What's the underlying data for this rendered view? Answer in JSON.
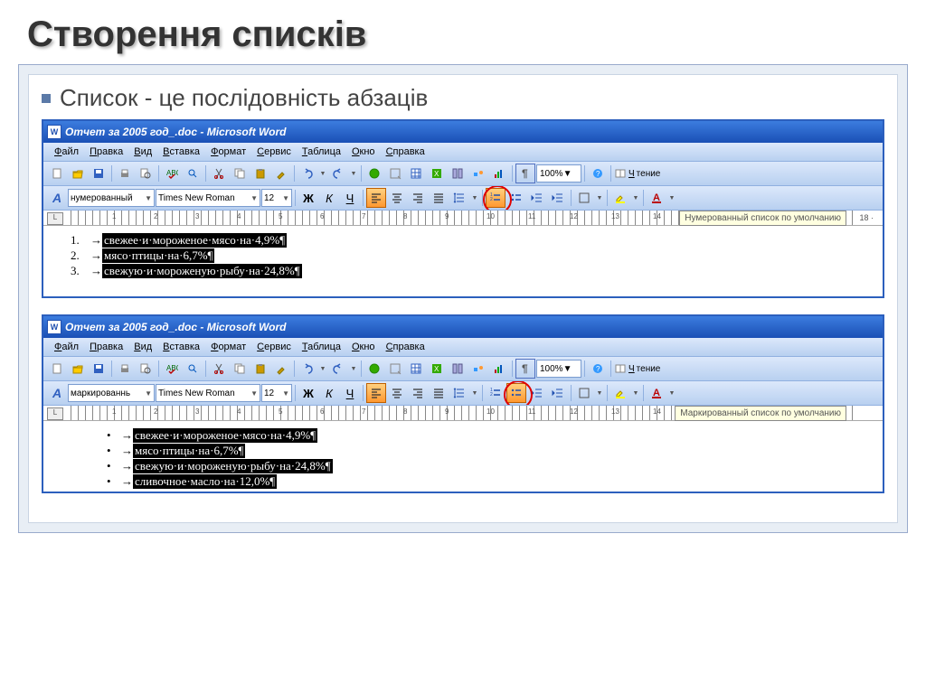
{
  "slide": {
    "title": "Створення списків",
    "subtitle": "Список - це послідовність абзаців"
  },
  "windows": [
    {
      "title": "Отчет за 2005 год_.doc - Microsoft Word",
      "menu": [
        "Файл",
        "Правка",
        "Вид",
        "Вставка",
        "Формат",
        "Сервис",
        "Таблица",
        "Окно",
        "Справка"
      ],
      "style": "нумерованный",
      "font": "Times New Roman",
      "size": "12",
      "zoom": "100%",
      "reading": "Чтение",
      "tooltip": "Нумерованный список по умолчанию",
      "ruler_end": "18",
      "list_type": "numbered",
      "items": [
        {
          "n": "1.",
          "text": "свежее·и·мороженое·мясо·на·4,9%¶"
        },
        {
          "n": "2.",
          "text": "мясо·птицы·на·6,7%¶"
        },
        {
          "n": "3.",
          "text": "свежую·и·мороженую·рыбу·на·24,8%¶"
        }
      ]
    },
    {
      "title": "Отчет за 2005 год_.doc - Microsoft Word",
      "menu": [
        "Файл",
        "Правка",
        "Вид",
        "Вставка",
        "Формат",
        "Сервис",
        "Таблица",
        "Окно",
        "Справка"
      ],
      "style": "маркированнь",
      "font": "Times New Roman",
      "size": "12",
      "zoom": "100%",
      "reading": "Чтение",
      "tooltip": "Маркированный список по умолчанию",
      "list_type": "bulleted",
      "items": [
        {
          "n": "•",
          "text": "свежее·и·мороженое·мясо·на·4,9%¶"
        },
        {
          "n": "•",
          "text": "мясо·птицы·на·6,7%¶"
        },
        {
          "n": "•",
          "text": "свежую·и·мороженую·рыбу·на·24,8%¶"
        },
        {
          "n": "•",
          "text": "сливочное·масло·на·12,0%¶"
        }
      ]
    }
  ]
}
